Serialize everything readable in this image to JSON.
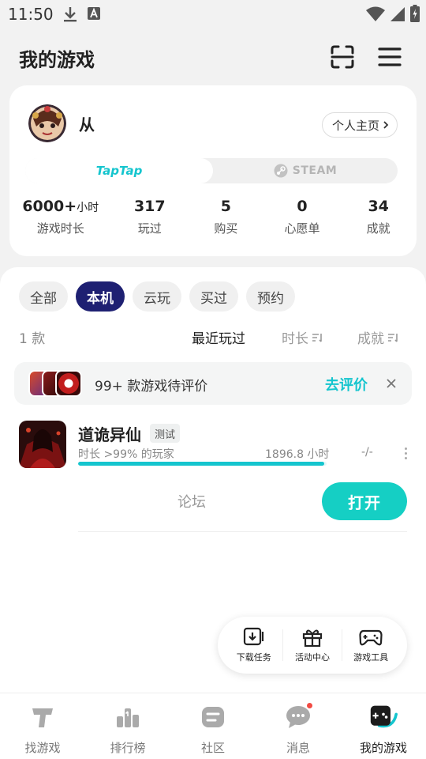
{
  "status_bar": {
    "time": "11:50"
  },
  "header": {
    "title": "我的游戏"
  },
  "profile": {
    "username": "从",
    "homepage_label": "个人主页",
    "platforms": {
      "taptap": "TapTap",
      "steam": "STEAM"
    },
    "stats": [
      {
        "value": "6000+",
        "unit": "小时",
        "label": "游戏时长"
      },
      {
        "value": "317",
        "unit": "",
        "label": "玩过"
      },
      {
        "value": "5",
        "unit": "",
        "label": "购买"
      },
      {
        "value": "0",
        "unit": "",
        "label": "心愿单"
      },
      {
        "value": "34",
        "unit": "",
        "label": "成就"
      }
    ]
  },
  "filters": {
    "tabs": [
      "全部",
      "本机",
      "云玩",
      "买过",
      "预约"
    ],
    "active": "本机"
  },
  "sort": {
    "count": "1 款",
    "recent": "最近玩过",
    "duration": "时长",
    "achievement": "成就"
  },
  "review_banner": {
    "text": "99+ 款游戏待评价",
    "action": "去评价"
  },
  "games": [
    {
      "title": "道诡异仙",
      "tag": "测试",
      "playtime_label": "时长 >99% 的玩家",
      "hours": "1896.8 小时",
      "progress": 0.99,
      "score": "-/-",
      "forum": "论坛",
      "open": "打开"
    }
  ],
  "tools": [
    {
      "label": "下载任务",
      "icon": "download-icon"
    },
    {
      "label": "活动中心",
      "icon": "gift-icon"
    },
    {
      "label": "游戏工具",
      "icon": "gamepad-icon"
    }
  ],
  "bottom_nav": [
    {
      "label": "找游戏",
      "icon": "taptap-logo-icon"
    },
    {
      "label": "排行榜",
      "icon": "ranking-icon"
    },
    {
      "label": "社区",
      "icon": "community-icon"
    },
    {
      "label": "消息",
      "icon": "message-icon",
      "has_badge": true
    },
    {
      "label": "我的游戏",
      "icon": "my-games-icon",
      "active": true
    }
  ],
  "colors": {
    "accent": "#15c5ce",
    "active_tab": "#1e2072",
    "badge": "#f24b43"
  }
}
